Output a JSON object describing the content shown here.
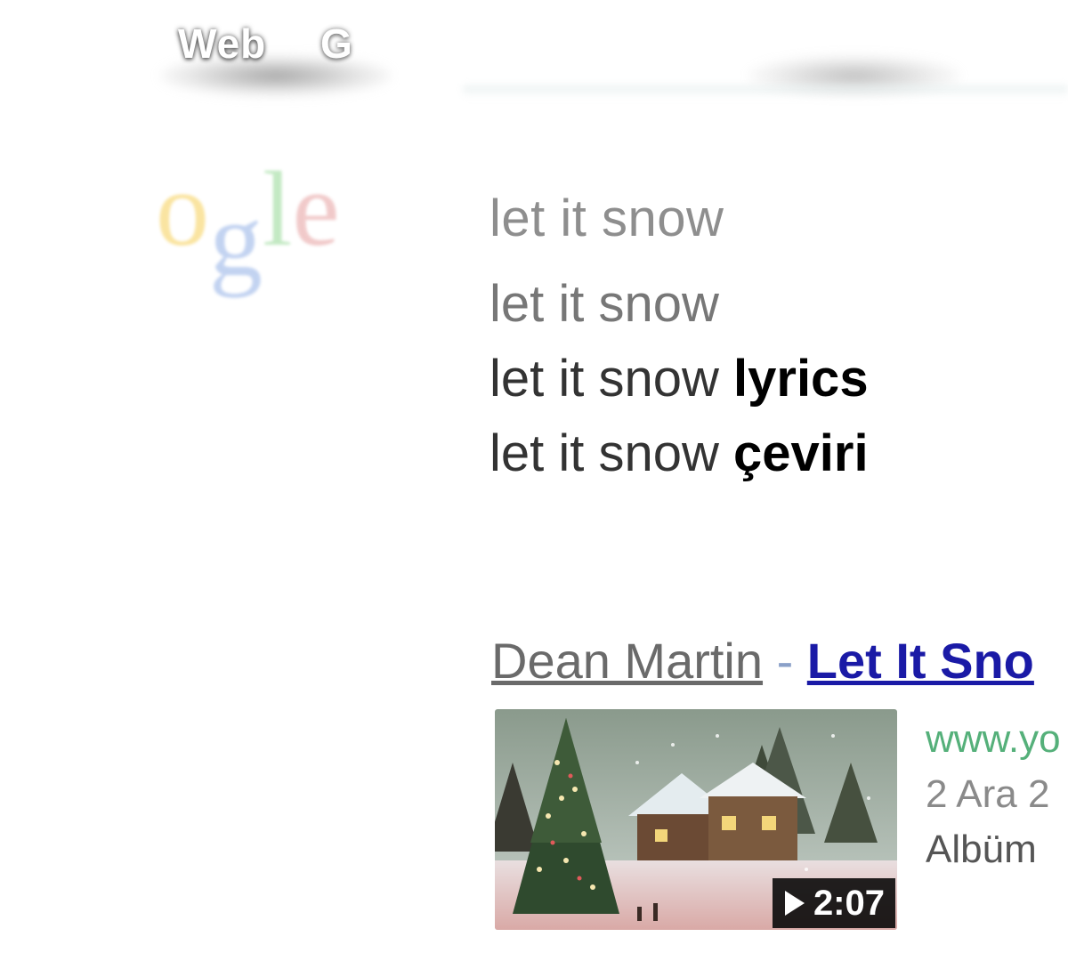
{
  "nav": {
    "items": [
      {
        "label": "Web"
      },
      {
        "label": "G"
      }
    ]
  },
  "logo": {
    "letters": [
      "o",
      "g",
      "l",
      "e"
    ],
    "colors": [
      "#f4c430",
      "#7a9ee0",
      "#7ccf7c",
      "#e08a8a"
    ]
  },
  "search": {
    "query": "let it snow"
  },
  "suggestions": [
    {
      "base": "let it snow",
      "extra": ""
    },
    {
      "base": "let it snow ",
      "extra": "lyrics"
    },
    {
      "base": "let it snow ",
      "extra": "çeviri"
    }
  ],
  "result": {
    "artist": "Dean Martin",
    "separator": " - ",
    "song": "Let It Sno",
    "video": {
      "duration": "2:07"
    },
    "meta": {
      "url": "www.yo",
      "date": "2 Ara 2",
      "type": "Albüm"
    }
  }
}
